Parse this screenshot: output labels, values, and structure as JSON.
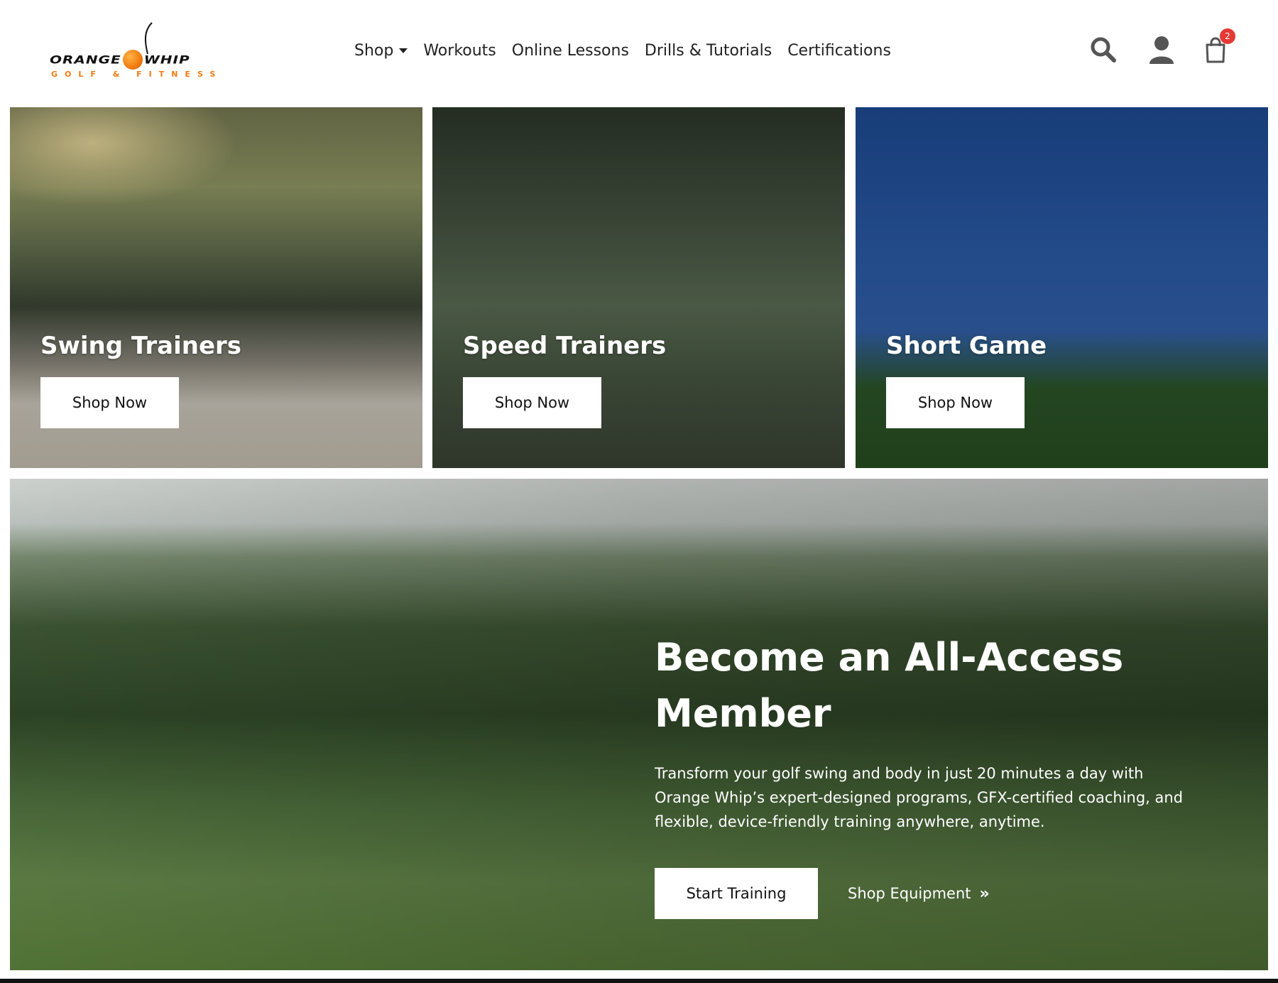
{
  "brand": {
    "name_left": "ORANGE",
    "name_right": "WHIP",
    "tagline": "GOLF & FITNESS",
    "accent_color": "#f07c10"
  },
  "nav": {
    "items": [
      {
        "label": "Shop",
        "has_dropdown": true
      },
      {
        "label": "Workouts"
      },
      {
        "label": "Online Lessons"
      },
      {
        "label": "Drills & Tutorials"
      },
      {
        "label": "Certifications"
      }
    ]
  },
  "header_icons": {
    "search": "search-icon",
    "account": "user-icon",
    "cart": "cart-icon",
    "cart_count": "2",
    "badge_color": "#e53935"
  },
  "categories": [
    {
      "title": "Swing Trainers",
      "button": "Shop Now"
    },
    {
      "title": "Speed Trainers",
      "button": "Shop Now"
    },
    {
      "title": "Short Game",
      "button": "Shop Now"
    }
  ],
  "hero": {
    "title": "Become an All-Access Member",
    "text": "Transform your golf swing and body in just 20 minutes a day with Orange Whip’s expert-designed programs, GFX-certified coaching, and flexible, device-friendly training anywhere, anytime.",
    "primary_button": "Start Training",
    "secondary_link": "Shop Equipment",
    "secondary_icon": "double-chevron-right-icon"
  }
}
